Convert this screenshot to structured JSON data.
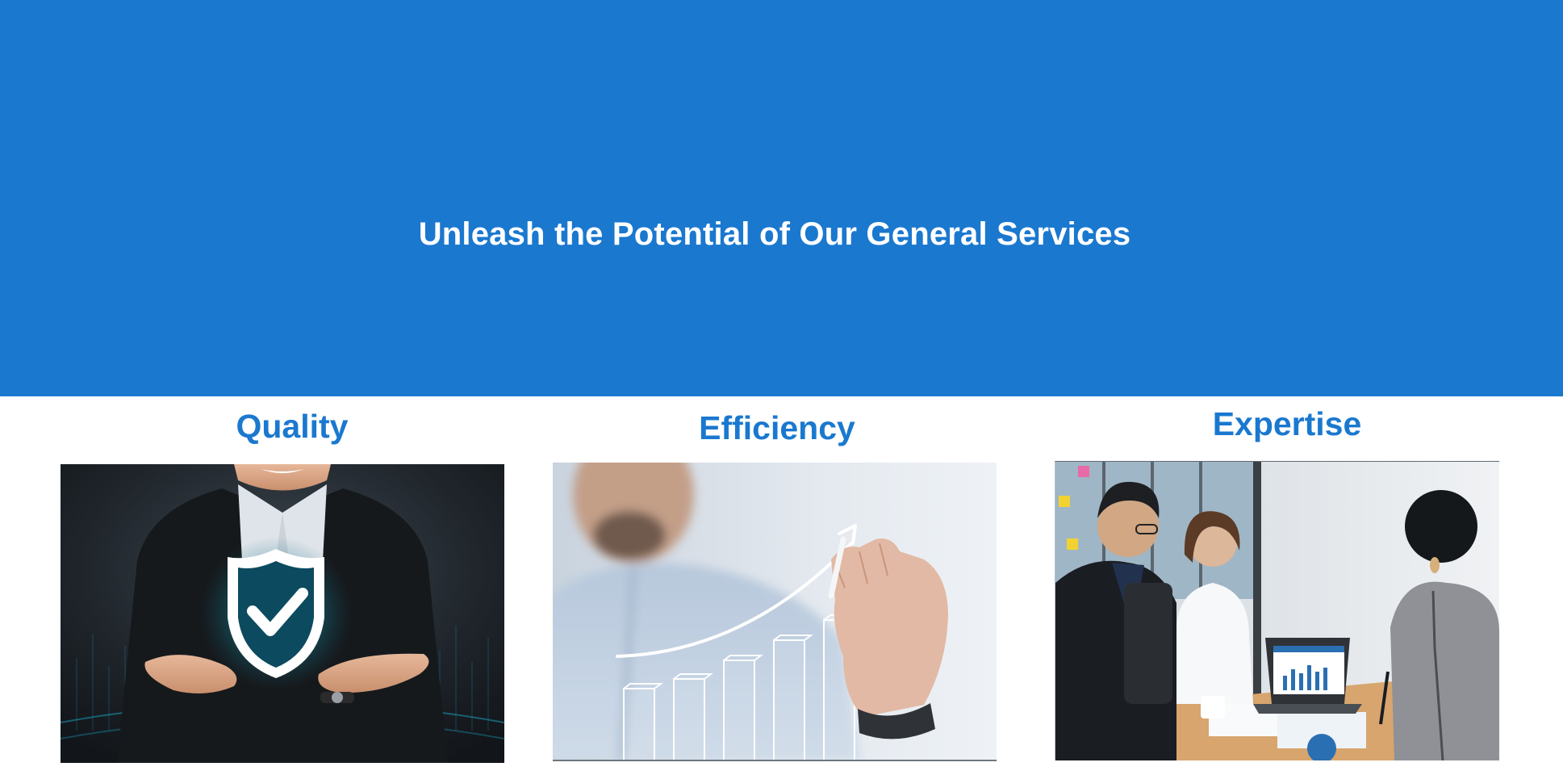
{
  "hero": {
    "title": "Unleash the Potential of Our General Services",
    "background_color": "#1a78cf"
  },
  "features": [
    {
      "title": "Quality",
      "image": "businessman-holding-shield-checkmark-photo"
    },
    {
      "title": "Efficiency",
      "image": "hand-drawing-growth-chart-arrow-photo"
    },
    {
      "title": "Expertise",
      "image": "business-team-meeting-laptop-photo"
    }
  ],
  "colors": {
    "accent": "#1a78cf",
    "text_on_accent": "#ffffff",
    "page_background": "#ffffff"
  }
}
